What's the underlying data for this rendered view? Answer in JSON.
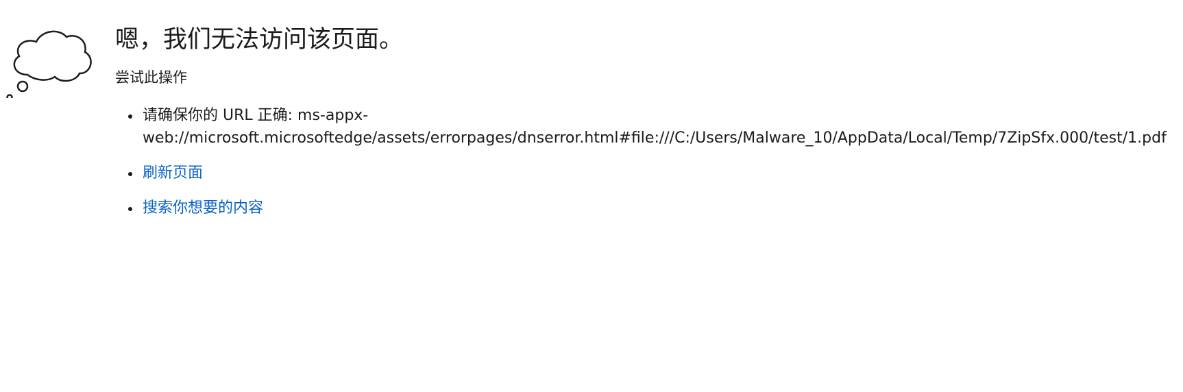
{
  "error_page": {
    "title": "嗯，我们无法访问该页面。",
    "subtitle": "尝试此操作",
    "suggestions": {
      "url_check_label": "请确保你的 URL 正确: ms-appx-",
      "url_value": "web://microsoft.microsoftedge/assets/errorpages/dnserror.html#file:///C:/Users/Malware_10/AppData/Local/Temp/7ZipSfx.000/test/1.pdf",
      "refresh_link": "刷新页面",
      "search_link": "搜索你想要的内容"
    },
    "illustration_icon": "thought-cloud-icon",
    "colors": {
      "text": "#1b1b1b",
      "link": "#0a63c5",
      "background": "#ffffff"
    }
  }
}
